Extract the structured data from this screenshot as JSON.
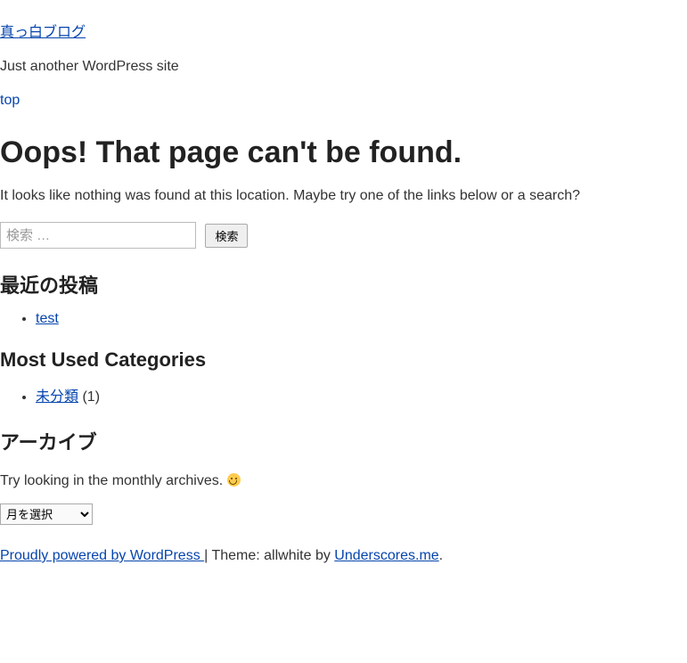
{
  "header": {
    "site_title": "真っ白ブログ",
    "site_description": "Just another WordPress site",
    "top_link": "top"
  },
  "error": {
    "title": "Oops! That page can't be found.",
    "description": "It looks like nothing was found at this location. Maybe try one of the links below or a search?"
  },
  "search": {
    "placeholder": "検索 …",
    "button_label": "検索"
  },
  "recent_posts": {
    "heading": "最近の投稿",
    "items": [
      {
        "title": "test"
      }
    ]
  },
  "categories": {
    "heading": "Most Used Categories",
    "items": [
      {
        "name": "未分類",
        "count_display": "(1)"
      }
    ]
  },
  "archives": {
    "heading": "アーカイブ",
    "description": "Try looking in the monthly archives. ",
    "select_default": "月を選択"
  },
  "footer": {
    "powered": "Proudly powered by WordPress ",
    "separator": "| ",
    "theme_prefix": "Theme: allwhite by ",
    "theme_link": "Underscores.me",
    "period": "."
  }
}
